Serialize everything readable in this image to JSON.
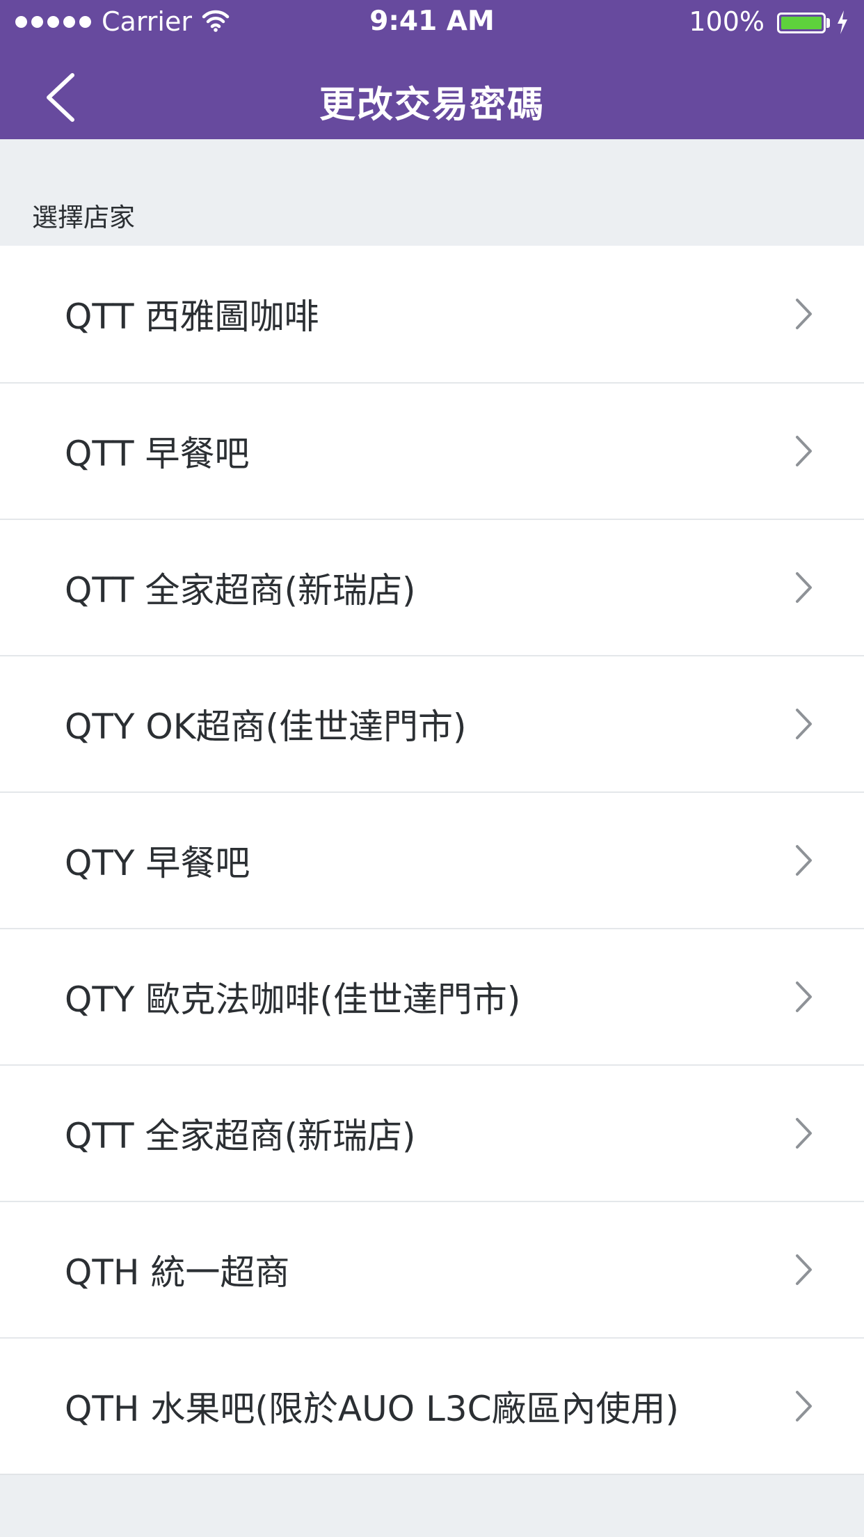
{
  "status_bar": {
    "carrier": "Carrier",
    "time": "9:41 AM",
    "battery_percent": "100%",
    "battery_level": 1.0,
    "battery_color": "#5ed23c"
  },
  "nav": {
    "title": "更改交易密碼",
    "back_icon": "chevron-left-icon",
    "background_color": "#674a9e"
  },
  "section": {
    "label": "選擇店家"
  },
  "stores": [
    {
      "label": "QTT 西雅圖咖啡"
    },
    {
      "label": "QTT 早餐吧"
    },
    {
      "label": "QTT 全家超商(新瑞店)"
    },
    {
      "label": "QTY OK超商(佳世達門市)"
    },
    {
      "label": "QTY 早餐吧"
    },
    {
      "label": "QTY 歐克法咖啡(佳世達門市)"
    },
    {
      "label": "QTT 全家超商(新瑞店)"
    },
    {
      "label": "QTH 統一超商"
    },
    {
      "label": "QTH 水果吧(限於AUO L3C廠區內使用)"
    }
  ],
  "row_icon": "chevron-right-icon"
}
